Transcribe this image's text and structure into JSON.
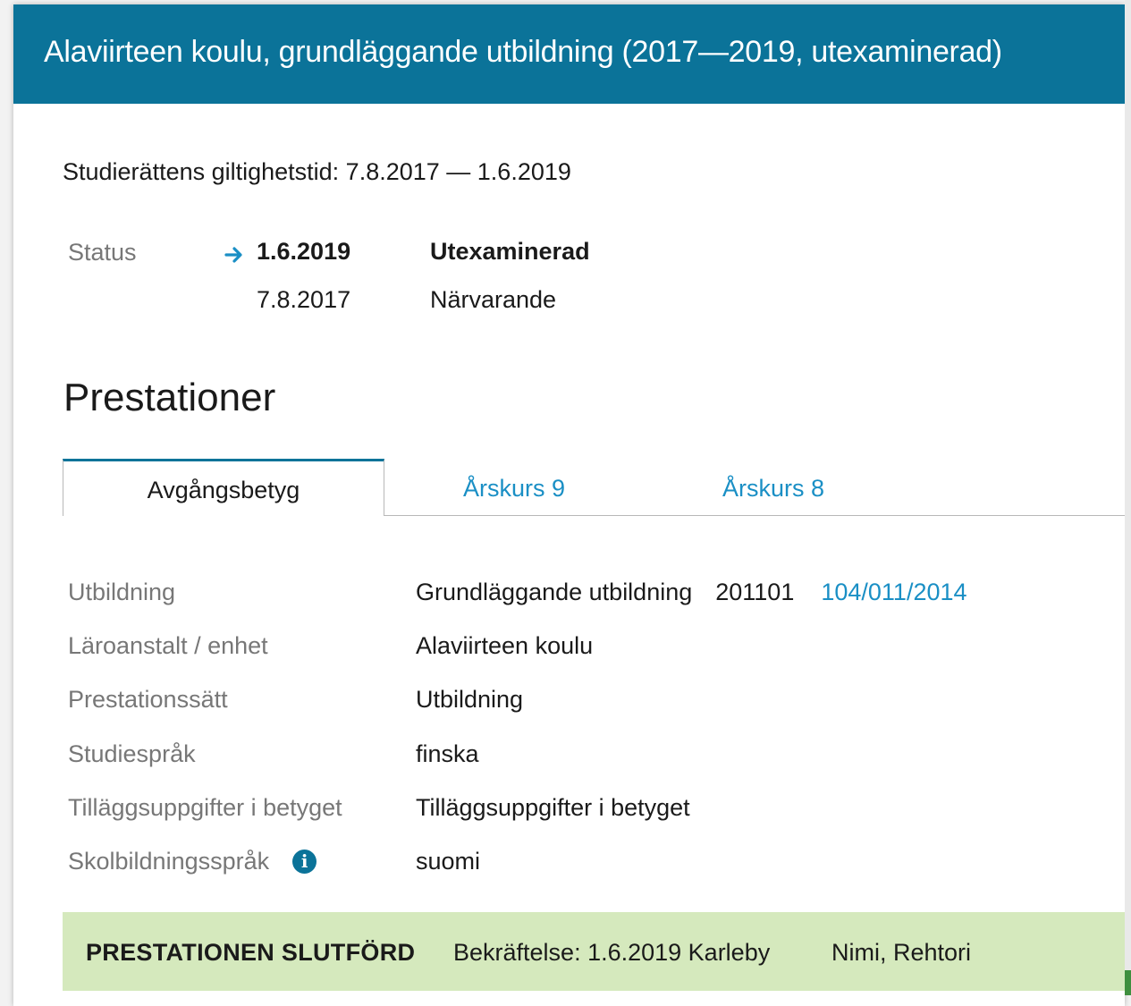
{
  "header": {
    "title": "Alaviirteen koulu, grundläggande utbildning (2017—2019, utexaminerad)"
  },
  "validity": "Studierättens giltighetstid: 7.8.2017 — 1.6.2019",
  "status": {
    "label": "Status",
    "entries": [
      {
        "date": "1.6.2019",
        "state": "Utexaminerad",
        "current": true
      },
      {
        "date": "7.8.2017",
        "state": "Närvarande",
        "current": false
      }
    ]
  },
  "section_title": "Prestationer",
  "tabs": [
    {
      "label": "Avgångsbetyg",
      "active": true
    },
    {
      "label": "Årskurs 9",
      "active": false
    },
    {
      "label": "Årskurs 8",
      "active": false
    }
  ],
  "properties": {
    "education": {
      "label": "Utbildning",
      "value": "Grundläggande utbildning",
      "code": "201101",
      "diary_number": "104/011/2014"
    },
    "institution": {
      "label": "Läroanstalt / enhet",
      "value": "Alaviirteen koulu"
    },
    "completion_method": {
      "label": "Prestationssätt",
      "value": "Utbildning"
    },
    "study_language": {
      "label": "Studiespråk",
      "value": "finska"
    },
    "additional_info": {
      "label": "Tilläggsuppgifter i betyget",
      "value": "Tilläggsuppgifter i betyget"
    },
    "school_language": {
      "label": "Skolbildningsspråk",
      "value": "suomi",
      "info_icon": "i"
    }
  },
  "completion": {
    "badge": "PRESTATIONEN SLUTFÖRD",
    "confirmation": "Bekräftelse: 1.6.2019 Karleby",
    "person": "Nimi, Rehtori"
  },
  "colors": {
    "header_bg": "#0b7399",
    "link": "#1a8fc5",
    "completed_bg": "#d5e9bd",
    "label_gray": "#777777"
  }
}
